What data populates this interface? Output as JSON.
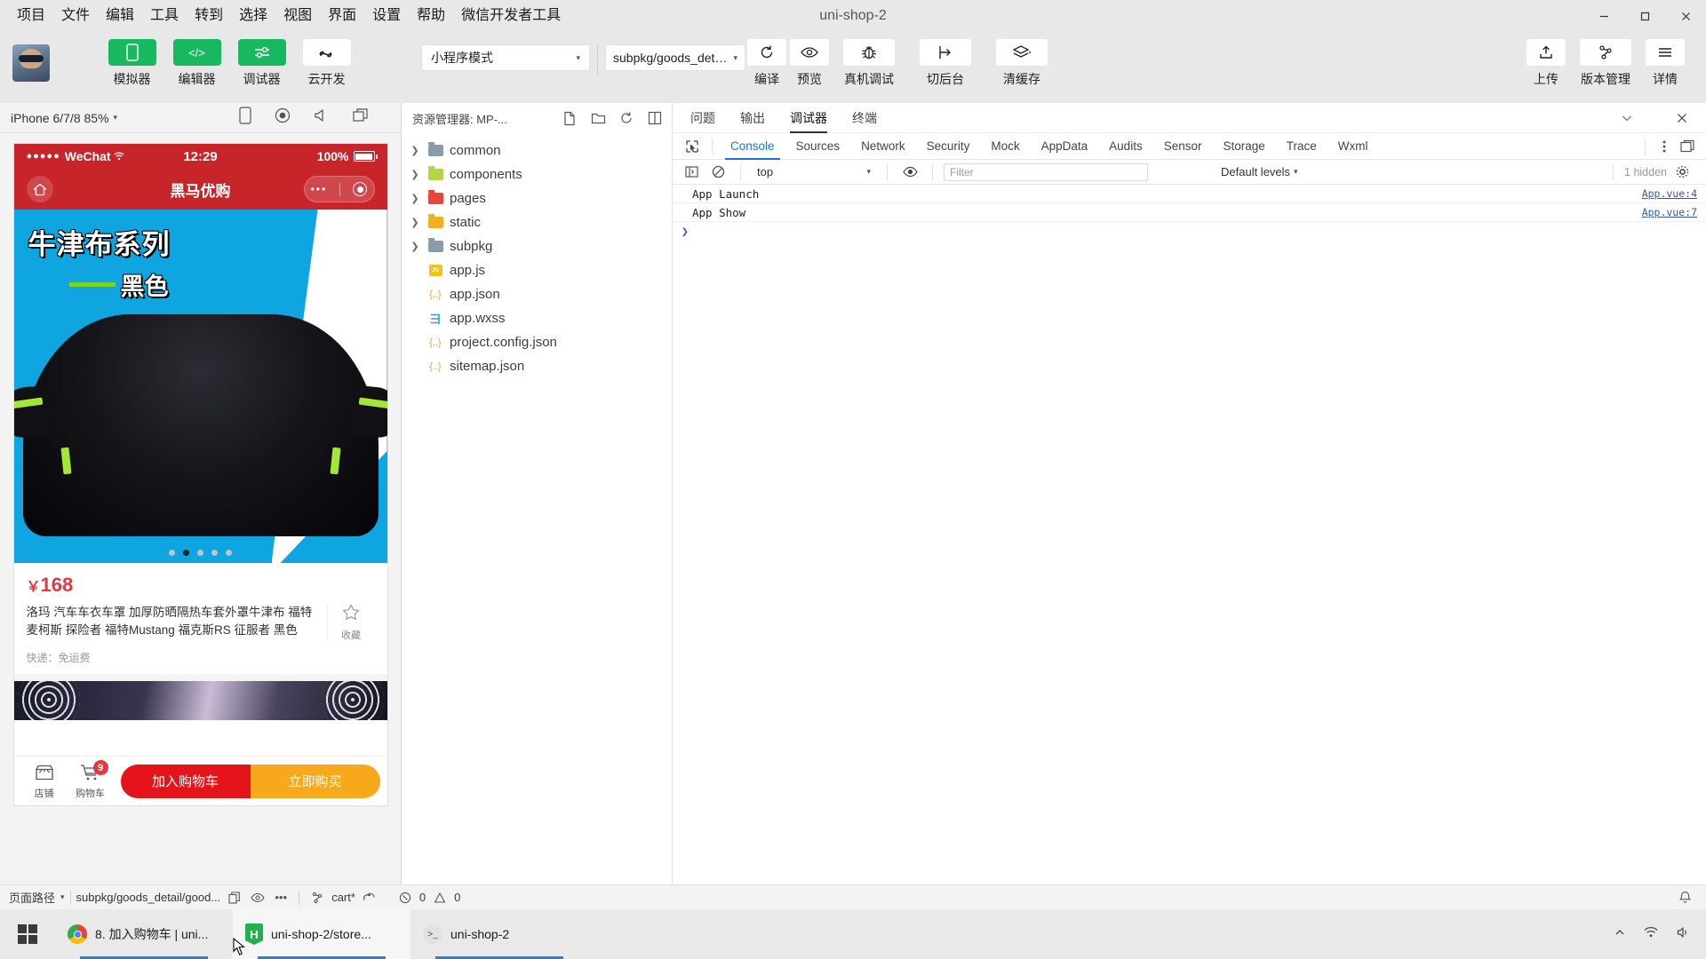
{
  "window": {
    "app_title": "微信开发者工具",
    "project_title": "uni-shop-2",
    "menus": [
      "项目",
      "文件",
      "编辑",
      "工具",
      "转到",
      "选择",
      "视图",
      "界面",
      "设置",
      "帮助"
    ],
    "controls": {
      "minimize": "minimize-icon",
      "maximize": "maximize-icon",
      "close": "close-icon"
    }
  },
  "toolbar": {
    "avatar": "user-avatar",
    "mode_buttons": [
      {
        "label": "模拟器",
        "icon": "phone-icon",
        "style": "green"
      },
      {
        "label": "编辑器",
        "icon": "code-icon",
        "style": "green"
      },
      {
        "label": "调试器",
        "icon": "sliders-icon",
        "style": "green"
      },
      {
        "label": "云开发",
        "icon": "cloud-s-icon",
        "style": "white"
      }
    ],
    "mode_select": {
      "value": "小程序模式",
      "caret": "▾"
    },
    "page_select": {
      "value": "subpkg/goods_deta...",
      "caret": "▾"
    },
    "action_buttons": [
      {
        "label": "编译",
        "icon": "refresh-icon"
      },
      {
        "label": "预览",
        "icon": "eye-icon"
      },
      {
        "label": "真机调试",
        "icon": "bug-icon"
      },
      {
        "label": "切后台",
        "icon": "background-icon"
      },
      {
        "label": "清缓存",
        "icon": "layers-icon",
        "caret": "▾"
      }
    ],
    "right_buttons": [
      {
        "label": "上传",
        "icon": "upload-icon"
      },
      {
        "label": "版本管理",
        "icon": "branch-icon"
      },
      {
        "label": "详情",
        "icon": "hamburger-icon"
      }
    ]
  },
  "simulator": {
    "device": "iPhone 6/7/8 85%",
    "device_caret": "▾",
    "head_icons": [
      "rotate-device-icon",
      "record-icon",
      "mute-icon",
      "popout-icon"
    ],
    "phone": {
      "status": {
        "signal": "●●●●●",
        "carrier": "WeChat",
        "wifi": "wifi-icon",
        "time": "12:29",
        "battery_text": "100%"
      },
      "nav": {
        "home": "home-icon",
        "title": "黑马优购",
        "menu_dots": "•••",
        "target": "target-icon"
      },
      "banner": {
        "headline": "牛津布系列",
        "subhead": "黑色",
        "dots_total": 5,
        "dots_active_index": 1
      },
      "product": {
        "currency": "￥",
        "price": "168",
        "title": "洛玛 汽车车衣车罩 加厚防晒隔热车套外罩牛津布 福特麦柯斯 探险者 福特Mustang 福克斯RS 征服者 黑色",
        "fav_label": "收藏",
        "fav_icon": "star-outline-icon",
        "shipping": "快递：免运费"
      },
      "tabbar": {
        "shop": {
          "label": "店铺",
          "icon": "shop-icon"
        },
        "cart": {
          "label": "购物车",
          "icon": "cart-icon",
          "badge": "9"
        },
        "add_to_cart": "加入购物车",
        "buy_now": "立即购买"
      }
    }
  },
  "explorer": {
    "title": "资源管理器: MP-...",
    "head_icons": [
      "new-file-icon",
      "new-folder-icon",
      "refresh-icon",
      "collapse-all-icon"
    ],
    "tree": [
      {
        "name": "common",
        "type": "folder",
        "color": "#8a9aa6",
        "expandable": true
      },
      {
        "name": "components",
        "type": "folder",
        "color": "#b4d44a",
        "expandable": true
      },
      {
        "name": "pages",
        "type": "folder",
        "color": "#e8453c",
        "expandable": true
      },
      {
        "name": "static",
        "type": "folder",
        "color": "#f2b01e",
        "expandable": true
      },
      {
        "name": "subpkg",
        "type": "folder",
        "color": "#8a9aa6",
        "expandable": true
      },
      {
        "name": "app.js",
        "type": "js",
        "color": "#f0c419",
        "glyph": "JS",
        "expandable": false
      },
      {
        "name": "app.json",
        "type": "json",
        "color": "#e8a33d",
        "glyph": "{..}",
        "expandable": false
      },
      {
        "name": "app.wxss",
        "type": "wxss",
        "color": "#3b9ce0",
        "glyph": "彐",
        "expandable": false
      },
      {
        "name": "project.config.json",
        "type": "json",
        "color": "#e8a33d",
        "glyph": "{..}",
        "expandable": false
      },
      {
        "name": "sitemap.json",
        "type": "json",
        "color": "#e8a33d",
        "glyph": "{..}",
        "expandable": false
      }
    ]
  },
  "devtools": {
    "panel_tabs": [
      {
        "label": "问题",
        "active": false
      },
      {
        "label": "输出",
        "active": false
      },
      {
        "label": "调试器",
        "active": true
      },
      {
        "label": "终端",
        "active": false
      }
    ],
    "panel_icons": [
      "chevron-down-icon",
      "close-icon"
    ],
    "inspector_tabs": [
      {
        "label": "Console",
        "active": true
      },
      {
        "label": "Sources",
        "active": false
      },
      {
        "label": "Network",
        "active": false
      },
      {
        "label": "Security",
        "active": false
      },
      {
        "label": "Mock",
        "active": false
      },
      {
        "label": "AppData",
        "active": false
      },
      {
        "label": "Audits",
        "active": false
      },
      {
        "label": "Sensor",
        "active": false
      },
      {
        "label": "Storage",
        "active": false
      },
      {
        "label": "Trace",
        "active": false
      },
      {
        "label": "Wxml",
        "active": false
      }
    ],
    "inspector_icons": [
      "select-element-icon",
      "more-vertical-icon",
      "dock-icon"
    ],
    "filter_bar": {
      "execute_icon": "sidebar-toggle-icon",
      "clear_icon": "clear-console-icon",
      "context": "top",
      "context_caret": "▾",
      "eye_icon": "eye-icon",
      "filter_placeholder": "Filter",
      "filter_value": "",
      "levels": "Default levels",
      "levels_caret": "▾",
      "hidden": "1 hidden",
      "settings_icon": "gear-icon"
    },
    "console_rows": [
      {
        "text": "App  Launch",
        "source": "App.vue:4"
      },
      {
        "text": "App  Show",
        "source": "App.vue:7"
      }
    ],
    "prompt": "❯"
  },
  "statusbar": {
    "page_path_label": "页面路径",
    "page_path_caret": "▾",
    "page_path": "subpkg/goods_detail/good...",
    "copy_icon": "copy-icon",
    "eye_icon": "eye-icon",
    "more_icon": "more-icon",
    "branch_icon": "branch-icon",
    "branch": "cart*",
    "sync_icon": "sync-icon",
    "errors_icon": "error-icon",
    "errors": "0",
    "warnings_icon": "warning-icon",
    "warnings": "0",
    "bell_icon": "bell-icon"
  },
  "taskbar": {
    "start": "windows-start-icon",
    "items": [
      {
        "label": "8. 加入购物车 | uni...",
        "icon": "chrome-icon",
        "active": false
      },
      {
        "label": "uni-shop-2/store...",
        "icon": "html-file-icon",
        "active": true
      },
      {
        "label": "uni-shop-2",
        "icon": "wechat-devtools-icon",
        "active": false
      }
    ],
    "tray": [
      "chevron-up-icon",
      "network-icon",
      "volume-icon"
    ]
  },
  "colors": {
    "accent_green": "#18b861",
    "wechat_red": "#c8252a",
    "price_red": "#e4393c",
    "cta_red": "#e4141a",
    "cta_orange": "#f7a91b",
    "devtools_blue": "#1a73e8",
    "banner_blue": "#0fa5e0"
  }
}
